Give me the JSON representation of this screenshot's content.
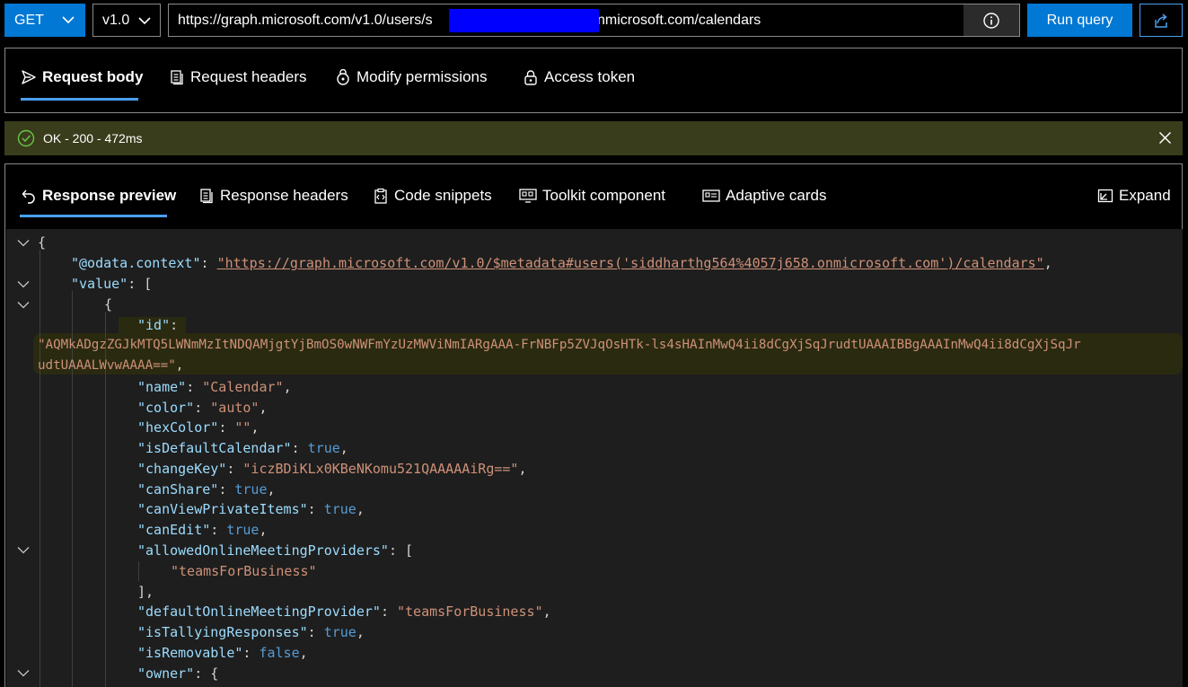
{
  "query": {
    "method": "GET",
    "version": "v1.0",
    "url_prefix": "https://graph.microsoft.com/v1.0/users/s",
    "url_suffix": ".onmicrosoft.com/calendars",
    "run_label": "Run query"
  },
  "request_tabs": [
    {
      "label": "Request body",
      "icon": "send-icon"
    },
    {
      "label": "Request headers",
      "icon": "document-icon"
    },
    {
      "label": "Modify permissions",
      "icon": "permissions-icon"
    },
    {
      "label": "Access token",
      "icon": "lock-icon"
    }
  ],
  "status": {
    "text": "OK - 200 - 472ms",
    "color": "#393d1b"
  },
  "response_tabs": [
    {
      "label": "Response preview",
      "icon": "undo-arrow-icon"
    },
    {
      "label": "Response headers",
      "icon": "document-icon"
    },
    {
      "label": "Code snippets",
      "icon": "code-icon"
    },
    {
      "label": "Toolkit component",
      "icon": "component-icon"
    },
    {
      "label": "Adaptive cards",
      "icon": "card-icon"
    }
  ],
  "expand_label": "Expand",
  "response": {
    "lines": [
      "{",
      "\"@odata.context\"",
      "\"https://graph.microsoft.com/v1.0/$metadata#users('siddharthg564%4057j658.onmicrosoft.com')/calendars\"",
      "\"value\"",
      "{",
      "\"id\"",
      "\"AQMkADgzZGJkMTQ5LWNmMzItNDQAMjgtYjBmOS0wNWFmYzUzMWViNmIARgAAA-FrNBFp5ZVJqOsHTk-ls4sHAInMwQ4ii8dCgXjSqJrudtUAAAIBBgAAAInMwQ4ii8dCgXjSqJr",
      "udtUAAALWvwAAAA==\"",
      "\"name\"",
      "\"Calendar\"",
      "\"color\"",
      "\"auto\"",
      "\"hexColor\"",
      "\"\"",
      "\"isDefaultCalendar\"",
      "true",
      "\"changeKey\"",
      "\"iczBDiKLx0KBeNKomu521QAAAAAiRg==\"",
      "\"canShare\"",
      "true",
      "\"canViewPrivateItems\"",
      "true",
      "\"canEdit\"",
      "true",
      "\"allowedOnlineMeetingProviders\"",
      "\"teamsForBusiness\"",
      "],",
      "\"defaultOnlineMeetingProvider\"",
      "\"teamsForBusiness\"",
      "\"isTallyingResponses\"",
      "true",
      "\"isRemovable\"",
      "false",
      "\"owner\""
    ]
  }
}
